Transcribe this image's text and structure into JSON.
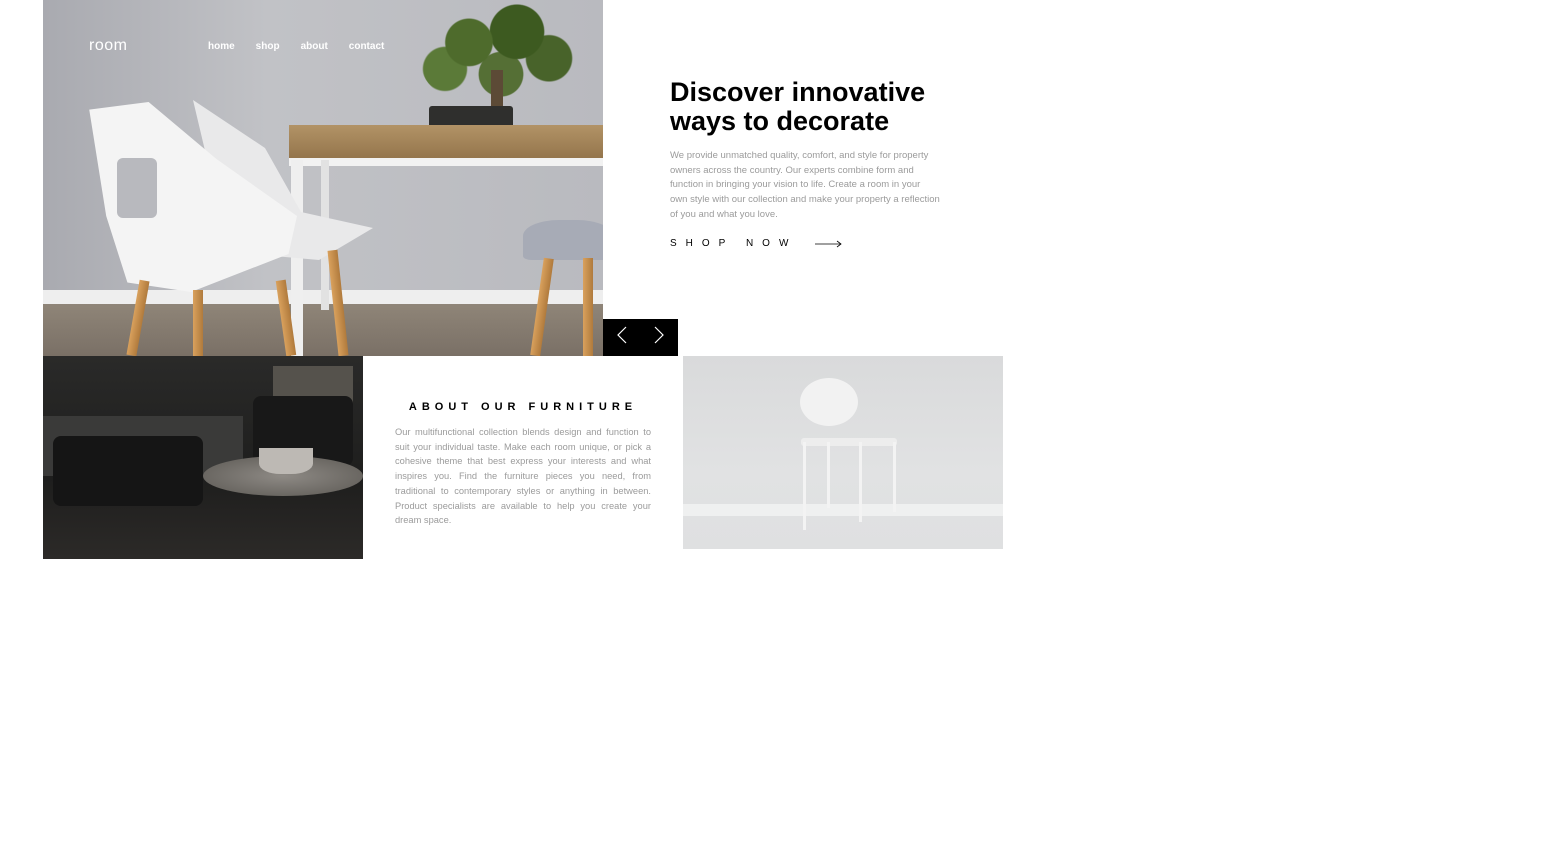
{
  "brand": {
    "logo": "room"
  },
  "nav": {
    "items": [
      "home",
      "shop",
      "about",
      "contact"
    ]
  },
  "hero": {
    "heading_line1": "Discover innovative",
    "heading_line2": "ways to decorate",
    "lead": "We provide unmatched quality, comfort, and style for property owners across the country. Our experts combine form and function in bringing your vision to life. Create a room in your own style with our collection and make your property a reflection of you and what you love.",
    "cta_label": "SHOP NOW",
    "cta_icon": "arrow-right-icon"
  },
  "slider": {
    "prev_icon": "chevron-left-icon",
    "next_icon": "chevron-right-icon"
  },
  "about": {
    "title": "ABOUT OUR FURNITURE",
    "text": "Our multifunctional collection blends design and function to suit your individual taste. Make each room unique, or pick a cohesive theme that best express your interests and what inspires you. Find the furniture pieces you need, from traditional to contemporary styles or anything in between. Product specialists are available to help you create your dream space."
  },
  "colors": {
    "text_dark": "#000000",
    "text_muted": "#9b9b9b",
    "control_bg": "#000000",
    "nav_text": "#ffffff"
  }
}
